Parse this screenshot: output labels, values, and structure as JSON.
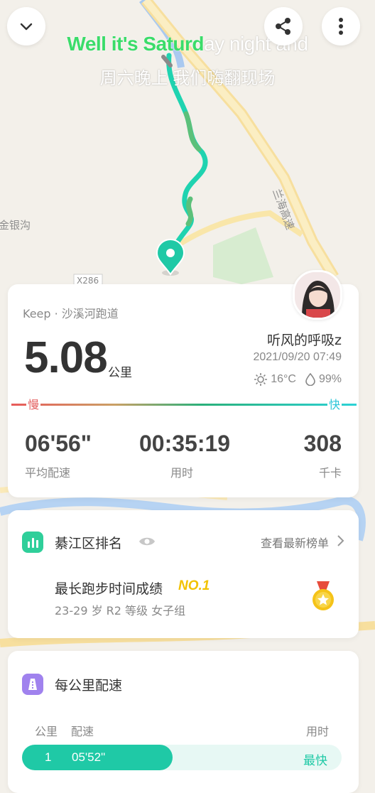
{
  "map": {
    "labels": {
      "road_vertical": "兰海高速",
      "place_left": "金银沟",
      "route_code": "X286",
      "road_lower": "兰海高速"
    },
    "route_colors": {
      "start": "#8a8a8a",
      "fast": "#1fd3b0",
      "mid": "#5cc07a"
    }
  },
  "lyrics": {
    "line1_highlight": "Well it's Saturd",
    "line1_rest": "ay night and",
    "line2": "周六晚上 我们嗨翻现场"
  },
  "summary": {
    "source": "Keep · 沙溪河跑道",
    "distance": "5.08",
    "distance_unit": "公里",
    "username": "听风的呼吸z",
    "datetime": "2021/09/20 07:49",
    "temperature": "16°C",
    "humidity": "99%",
    "pace_scale": {
      "slow": "慢",
      "fast": "快"
    },
    "stats": [
      {
        "value": "06'56\"",
        "label": "平均配速"
      },
      {
        "value": "00:35:19",
        "label": "用时"
      },
      {
        "value": "308",
        "label": "千卡"
      }
    ]
  },
  "ranking": {
    "title": "綦江区排名",
    "link": "查看最新榜单",
    "achievement": "最长跑步时间成绩",
    "rank": "NO.1",
    "group": "23-29 岁 R2 等级 女子组"
  },
  "splits": {
    "title": "每公里配速",
    "headers": {
      "km": "公里",
      "pace": "配速",
      "time": "用时"
    },
    "rows": [
      {
        "km": "1",
        "pace": "05'52\"",
        "tag": "最快",
        "fraction_of_max": 0.47
      }
    ]
  },
  "colors": {
    "accent": "#1fc9a6",
    "slow": "#e36060",
    "fast": "#2cc6d8",
    "gold": "#f2c200",
    "rank_icon": "#2fcf9a",
    "split_icon": "#a082ee"
  },
  "icons": [
    "chevron-down-icon",
    "share-icon",
    "more-vertical-icon",
    "sun-icon",
    "humidity-drop-icon",
    "bar-chart-icon",
    "eye-icon",
    "chevron-right-icon",
    "medal-icon",
    "pace-list-icon",
    "location-pin-icon"
  ]
}
